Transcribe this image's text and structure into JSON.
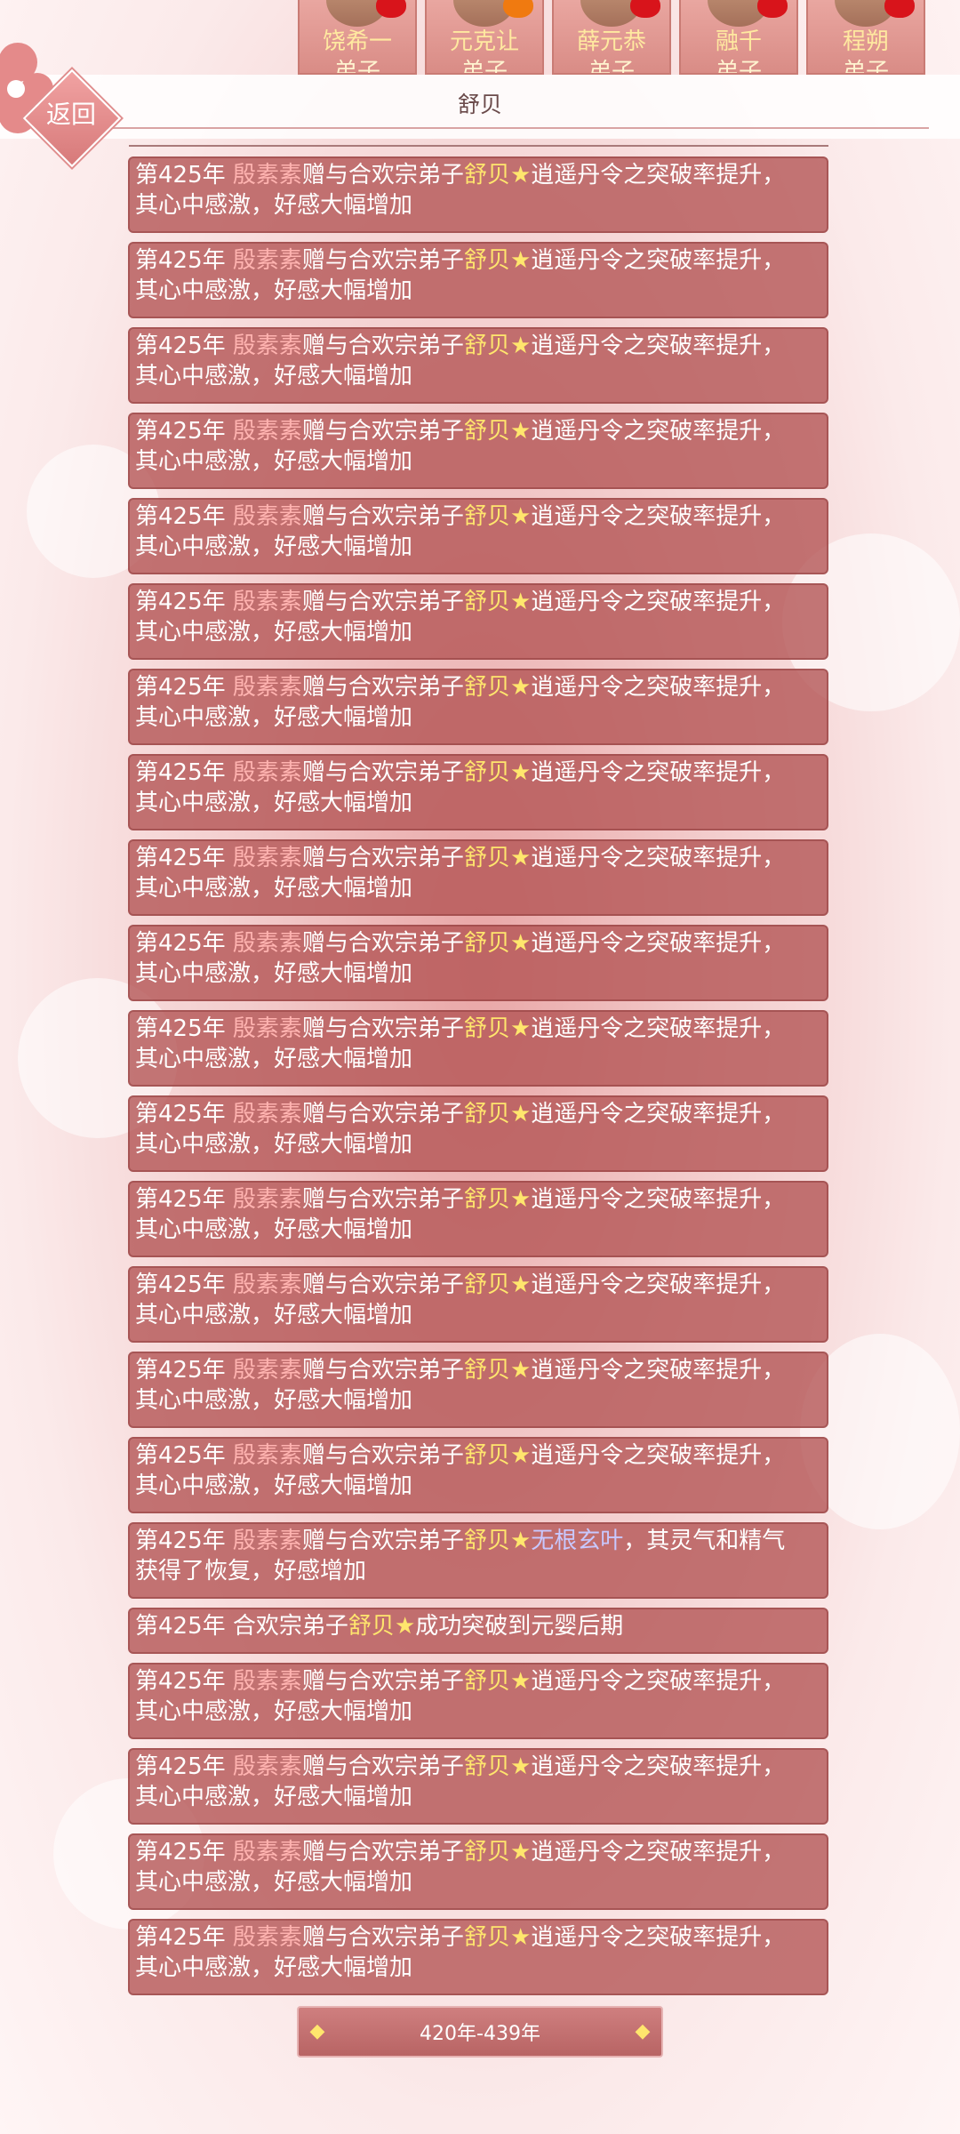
{
  "characters": [
    {
      "name": "饶希一",
      "role": "弟子",
      "heart": "red"
    },
    {
      "name": "元克让",
      "role": "弟子",
      "heart": "orange"
    },
    {
      "name": "薛元恭",
      "role": "弟子",
      "heart": "red"
    },
    {
      "name": "融千",
      "role": "弟子",
      "heart": "red"
    },
    {
      "name": "程朔",
      "role": "弟子",
      "heart": "red"
    }
  ],
  "header": {
    "title": "舒贝",
    "back_label": "返回"
  },
  "log": {
    "year_prefix": "第425年 ",
    "giver": "殷素素",
    "gift_verb": "赠与合欢宗弟子",
    "recipient": "舒贝",
    "star": "★",
    "item_breakthrough": "逍遥丹令之突破率提升，",
    "line2_breakthrough": "其心中感激，好感大幅增加",
    "item_herb": "无根玄叶",
    "herb_tail": "，其灵气和精气",
    "line2_herb": "获得了恢复，好感增加",
    "breakthrough_prefix": "合欢宗弟子",
    "breakthrough_text": "成功突破到元婴后期"
  },
  "entries": [
    "a",
    "a",
    "a",
    "a",
    "a",
    "a",
    "a",
    "a",
    "a",
    "a",
    "a",
    "a",
    "a",
    "a",
    "a",
    "a",
    "b",
    "c",
    "a",
    "a",
    "a",
    "a"
  ],
  "pager": {
    "label": "420年-439年"
  }
}
